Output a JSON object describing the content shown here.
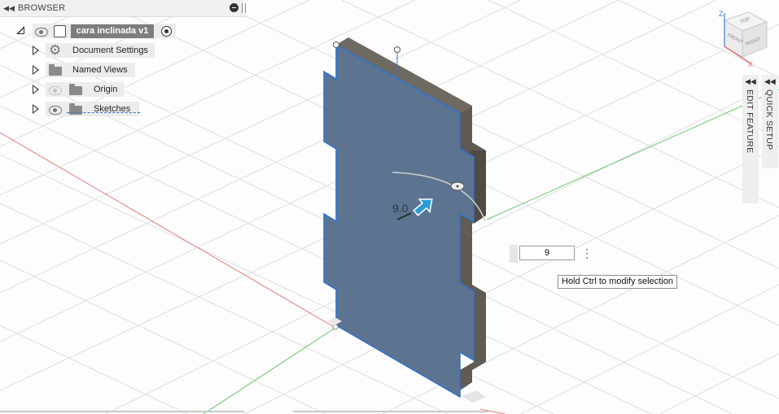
{
  "browser": {
    "title": "BROWSER",
    "document_name": "cara inclinada v1",
    "items": [
      {
        "label": "Document Settings"
      },
      {
        "label": "Named Views"
      },
      {
        "label": "Origin"
      },
      {
        "label": "Sketches"
      }
    ]
  },
  "panels": {
    "edit_feature": "EDIT FEATURE",
    "quick_setup": "QUICK SETUP"
  },
  "dimension": {
    "input_value": "9",
    "readout": "9.0"
  },
  "tooltip": "Hold Ctrl to modify selection",
  "viewcube": {
    "top": "TOP",
    "front": "FRONT",
    "right": "RIGHT",
    "axis_z": "Z",
    "axis_x": "X"
  },
  "colors": {
    "face": "#5c7490",
    "edge_highlight": "#2d73d6",
    "side_face": "#5f5a52",
    "grid": "#dadada",
    "axis_red": "#e06060",
    "axis_green": "#5fc45f"
  }
}
